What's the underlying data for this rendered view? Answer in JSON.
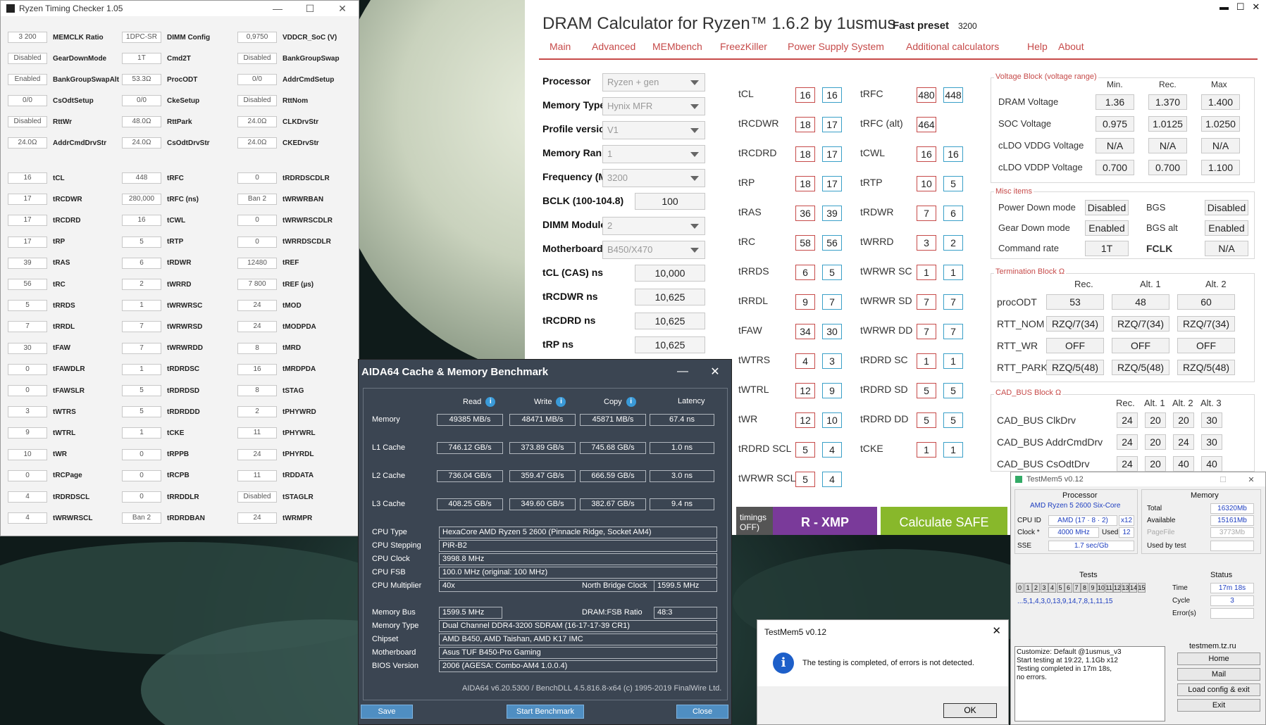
{
  "rtc": {
    "title": "Ryzen Timing Checker 1.05",
    "col1": [
      [
        "3 200",
        "MEMCLK Ratio"
      ],
      [
        "Disabled",
        "GearDownMode"
      ],
      [
        "Enabled",
        "BankGroupSwapAlt"
      ],
      [
        "0/0",
        "CsOdtSetup"
      ],
      [
        "Disabled",
        "RttWr"
      ],
      [
        "24.0Ω",
        "AddrCmdDrvStr"
      ]
    ],
    "col2": [
      [
        "1DPC-SR",
        "DIMM Config"
      ],
      [
        "1T",
        "Cmd2T"
      ],
      [
        "53.3Ω",
        "ProcODT"
      ],
      [
        "0/0",
        "CkeSetup"
      ],
      [
        "48.0Ω",
        "RttPark"
      ],
      [
        "24.0Ω",
        "CsOdtDrvStr"
      ]
    ],
    "col3": [
      [
        "0,9750",
        "VDDCR_SoC (V)"
      ],
      [
        "Disabled",
        "BankGroupSwap"
      ],
      [
        "0/0",
        "AddrCmdSetup"
      ],
      [
        "Disabled",
        "RttNom"
      ],
      [
        "24.0Ω",
        "CLKDrvStr"
      ],
      [
        "24.0Ω",
        "CKEDrvStr"
      ]
    ],
    "t1": [
      [
        "16",
        "tCL"
      ],
      [
        "17",
        "tRCDWR"
      ],
      [
        "17",
        "tRCDRD"
      ],
      [
        "17",
        "tRP"
      ],
      [
        "39",
        "tRAS"
      ],
      [
        "56",
        "tRC"
      ],
      [
        "5",
        "tRRDS"
      ],
      [
        "7",
        "tRRDL"
      ],
      [
        "30",
        "tFAW"
      ],
      [
        "0",
        "tFAWDLR"
      ],
      [
        "0",
        "tFAWSLR"
      ],
      [
        "3",
        "tWTRS"
      ],
      [
        "9",
        "tWTRL"
      ],
      [
        "10",
        "tWR"
      ],
      [
        "0",
        "tRCPage"
      ],
      [
        "4",
        "tRDRDSCL"
      ],
      [
        "4",
        "tWRWRSCL"
      ]
    ],
    "t2": [
      [
        "448",
        "tRFC"
      ],
      [
        "280,000",
        "tRFC (ns)"
      ],
      [
        "16",
        "tCWL"
      ],
      [
        "5",
        "tRTP"
      ],
      [
        "6",
        "tRDWR"
      ],
      [
        "2",
        "tWRRD"
      ],
      [
        "1",
        "tWRWRSC"
      ],
      [
        "7",
        "tWRWRSD"
      ],
      [
        "7",
        "tWRWRDD"
      ],
      [
        "1",
        "tRDRDSC"
      ],
      [
        "5",
        "tRDRDSD"
      ],
      [
        "5",
        "tRDRDDD"
      ],
      [
        "1",
        "tCKE"
      ],
      [
        "0",
        "tRPPB"
      ],
      [
        "0",
        "tRCPB"
      ],
      [
        "0",
        "tRRDDLR"
      ],
      [
        "Ban 2",
        "tRDRDBAN"
      ]
    ],
    "t3": [
      [
        "0",
        "tRDRDSCDLR"
      ],
      [
        "Ban 2",
        "tWRWRBAN"
      ],
      [
        "0",
        "tWRWRSCDLR"
      ],
      [
        "0",
        "tWRRDSCDLR"
      ],
      [
        "12480",
        "tREF"
      ],
      [
        "7 800",
        "tREF (µs)"
      ],
      [
        "24",
        "tMOD"
      ],
      [
        "24",
        "tMODPDA"
      ],
      [
        "8",
        "tMRD"
      ],
      [
        "16",
        "tMRDPDA"
      ],
      [
        "8",
        "tSTAG"
      ],
      [
        "2",
        "tPHYWRD"
      ],
      [
        "11",
        "tPHYWRL"
      ],
      [
        "24",
        "tPHYRDL"
      ],
      [
        "11",
        "tRDDATA"
      ],
      [
        "Disabled",
        "tSTAGLR"
      ],
      [
        "24",
        "tWRMPR"
      ]
    ]
  },
  "dc": {
    "title": "DRAM Calculator for Ryzen™ 1.6.2 by 1usmus",
    "fast_label": "Fast preset",
    "fast_value": "3200",
    "tabs": [
      "Main",
      "Advanced",
      "MEMbench",
      "FreezKiller",
      "Power Supply System",
      "Additional calculators",
      "Help",
      "About"
    ],
    "params": [
      [
        "Processor",
        "Ryzen + gen",
        "sel"
      ],
      [
        "Memory Type",
        "Hynix MFR",
        "sel"
      ],
      [
        "Profile version",
        "V1",
        "sel"
      ],
      [
        "Memory Rank",
        "1",
        "sel"
      ],
      [
        "Frequency (MT/s)",
        "3200",
        "sel"
      ],
      [
        "BCLK (100-104.8)",
        "100",
        "inp"
      ],
      [
        "DIMM Modules",
        "2",
        "sel"
      ],
      [
        "Motherboard",
        "B450/X470",
        "sel"
      ],
      [
        "tCL (CAS) ns",
        "10,000",
        "inp"
      ],
      [
        "tRCDWR ns",
        "10,625",
        "inp"
      ],
      [
        "tRCDRD ns",
        "10,625",
        "inp"
      ],
      [
        "tRP ns",
        "10,625",
        "inp"
      ]
    ],
    "timL": [
      [
        "tCL",
        "16",
        "16"
      ],
      [
        "tRCDWR",
        "18",
        "17"
      ],
      [
        "tRCDRD",
        "18",
        "17"
      ],
      [
        "tRP",
        "18",
        "17"
      ],
      [
        "tRAS",
        "36",
        "39"
      ],
      [
        "tRC",
        "58",
        "56"
      ],
      [
        "tRRDS",
        "6",
        "5"
      ],
      [
        "tRRDL",
        "9",
        "7"
      ],
      [
        "tFAW",
        "34",
        "30"
      ],
      [
        "tWTRS",
        "4",
        "3"
      ],
      [
        "tWTRL",
        "12",
        "9"
      ],
      [
        "tWR",
        "12",
        "10"
      ],
      [
        "tRDRD SCL",
        "5",
        "4"
      ],
      [
        "tWRWR SCL",
        "5",
        "4"
      ]
    ],
    "timR": [
      [
        "tRFC",
        "480",
        "448"
      ],
      [
        "tRFC (alt)",
        "464",
        ""
      ],
      [
        "tCWL",
        "16",
        "16"
      ],
      [
        "tRTP",
        "10",
        "5"
      ],
      [
        "tRDWR",
        "7",
        "6"
      ],
      [
        "tWRRD",
        "3",
        "2"
      ],
      [
        "tWRWR SC",
        "1",
        "1"
      ],
      [
        "tWRWR SD",
        "7",
        "7"
      ],
      [
        "tWRWR DD",
        "7",
        "7"
      ],
      [
        "tRDRD SC",
        "1",
        "1"
      ],
      [
        "tRDRD SD",
        "5",
        "5"
      ],
      [
        "tRDRD DD",
        "5",
        "5"
      ],
      [
        "tCKE",
        "1",
        "1"
      ]
    ],
    "volt": {
      "label": "Voltage Block (voltage range)",
      "heads": [
        "Min.",
        "Rec.",
        "Max"
      ],
      "rows": [
        [
          "DRAM Voltage",
          "1.36",
          "1.370",
          "1.400"
        ],
        [
          "SOC Voltage",
          "0.975",
          "1.0125",
          "1.0250"
        ],
        [
          "cLDO VDDG Voltage",
          "N/A",
          "N/A",
          "N/A"
        ],
        [
          "cLDO VDDP Voltage",
          "0.700",
          "0.700",
          "1.100"
        ]
      ]
    },
    "misc": {
      "label": "Misc items",
      "rows": [
        [
          "Power Down mode",
          "Disabled",
          "BGS",
          "Disabled"
        ],
        [
          "Gear Down mode",
          "Enabled",
          "BGS alt",
          "Enabled"
        ],
        [
          "Command rate",
          "1T",
          "FCLK",
          "N/A"
        ]
      ]
    },
    "term": {
      "label": "Termination Block Ω",
      "heads": [
        "Rec.",
        "Alt. 1",
        "Alt. 2"
      ],
      "rows": [
        [
          "procODT",
          "53",
          "48",
          "60"
        ],
        [
          "RTT_NOM",
          "RZQ/7(34)",
          "RZQ/7(34)",
          "RZQ/7(34)"
        ],
        [
          "RTT_WR",
          "OFF",
          "OFF",
          "OFF"
        ],
        [
          "RTT_PARK",
          "RZQ/5(48)",
          "RZQ/5(48)",
          "RZQ/5(48)"
        ]
      ]
    },
    "cad": {
      "label": "CAD_BUS Block Ω",
      "heads": [
        "Rec.",
        "Alt. 1",
        "Alt. 2",
        "Alt. 3"
      ],
      "rows": [
        [
          "CAD_BUS ClkDrv",
          "24",
          "20",
          "20",
          "30"
        ],
        [
          "CAD_BUS AddrCmdDrv",
          "24",
          "20",
          "24",
          "30"
        ],
        [
          "CAD_BUS CsOdtDrv",
          "24",
          "20",
          "40",
          "40"
        ]
      ]
    },
    "btn_partial": "timings\nOFF)",
    "btn_xmp": "R - XMP",
    "btn_safe": "Calculate SAFE"
  },
  "aida": {
    "title": "AIDA64 Cache & Memory Benchmark",
    "heads": [
      "Read",
      "Write",
      "Copy",
      "Latency"
    ],
    "rows": [
      [
        "Memory",
        "49385 MB/s",
        "48471 MB/s",
        "45871 MB/s",
        "67.4 ns"
      ],
      [
        "L1 Cache",
        "746.12 GB/s",
        "373.89 GB/s",
        "745.68 GB/s",
        "1.0 ns"
      ],
      [
        "L2 Cache",
        "736.04 GB/s",
        "359.47 GB/s",
        "666.59 GB/s",
        "3.0 ns"
      ],
      [
        "L3 Cache",
        "408.25 GB/s",
        "349.60 GB/s",
        "382.67 GB/s",
        "9.4 ns"
      ]
    ],
    "info": [
      [
        "CPU Type",
        "HexaCore AMD Ryzen 5 2600  (Pinnacle Ridge, Socket AM4)"
      ],
      [
        "CPU Stepping",
        "PiR-B2"
      ],
      [
        "CPU Clock",
        "3998.8 MHz"
      ],
      [
        "CPU FSB",
        "100.0 MHz  (original: 100 MHz)"
      ]
    ],
    "mult_label": "CPU Multiplier",
    "mult": "40x",
    "nb_label": "North Bridge Clock",
    "nb": "1599.5 MHz",
    "bus_label": "Memory Bus",
    "bus": "1599.5 MHz",
    "ratio_label": "DRAM:FSB Ratio",
    "ratio": "48:3",
    "info2": [
      [
        "Memory Type",
        "Dual Channel DDR4-3200 SDRAM  (16-17-17-39 CR1)"
      ],
      [
        "Chipset",
        "AMD B450, AMD Taishan, AMD K17 IMC"
      ],
      [
        "Motherboard",
        "Asus TUF B450-Pro Gaming"
      ],
      [
        "BIOS Version",
        "2006  (AGESA: Combo-AM4 1.0.0.4)"
      ]
    ],
    "footer": "AIDA64 v6.20.5300 / BenchDLL 4.5.816.8-x64  (c) 1995-2019 FinalWire Ltd.",
    "save": "Save",
    "start": "Start Benchmark",
    "close": "Close"
  },
  "tm": {
    "title": "TestMem5 v0.12",
    "proc_h": "Processor",
    "mem_h": "Memory",
    "cpu": "AMD Ryzen 5 2600 Six-Core",
    "cpuid_l": "CPU ID",
    "cpuid": "AMD  (17 · 8 · 2)",
    "x12": "x12",
    "clock_l": "Clock *",
    "clock": "4000 MHz",
    "used_l": "Used",
    "used": "12",
    "sse_l": "SSE",
    "sse": "1.7 sec/Gb",
    "total_l": "Total",
    "total": "16320Mb",
    "avail_l": "Available",
    "avail": "15161Mb",
    "pf_l": "PageFile",
    "pf": "3773Mb",
    "ubt_l": "Used by test",
    "ubt": "",
    "tests_h": "Tests",
    "status_h": "Status",
    "tests": [
      "0",
      "1",
      "2",
      "3",
      "4",
      "5",
      "6",
      "7",
      "8",
      "9",
      "10",
      "11",
      "12",
      "13",
      "14",
      "15"
    ],
    "seq": "...5,1,4,3,0,13,9,14,7,8,1,11,15",
    "time_l": "Time",
    "time": "17m 18s",
    "cycle_l": "Cycle",
    "cycle": "3",
    "err_l": "Error(s)",
    "err": "",
    "log": [
      "Customize: Default @1usmus_v3",
      "Start testing at 19:22, 1.1Gb x12",
      "Testing completed in 17m 18s,",
      "no errors."
    ],
    "site": "testmem.tz.ru",
    "btns": [
      "Home",
      "Mail",
      "Load config & exit",
      "Exit"
    ]
  },
  "dlg": {
    "title": "TestMem5 v0.12",
    "msg": "The testing is completed, of errors is not detected.",
    "ok": "OK"
  }
}
